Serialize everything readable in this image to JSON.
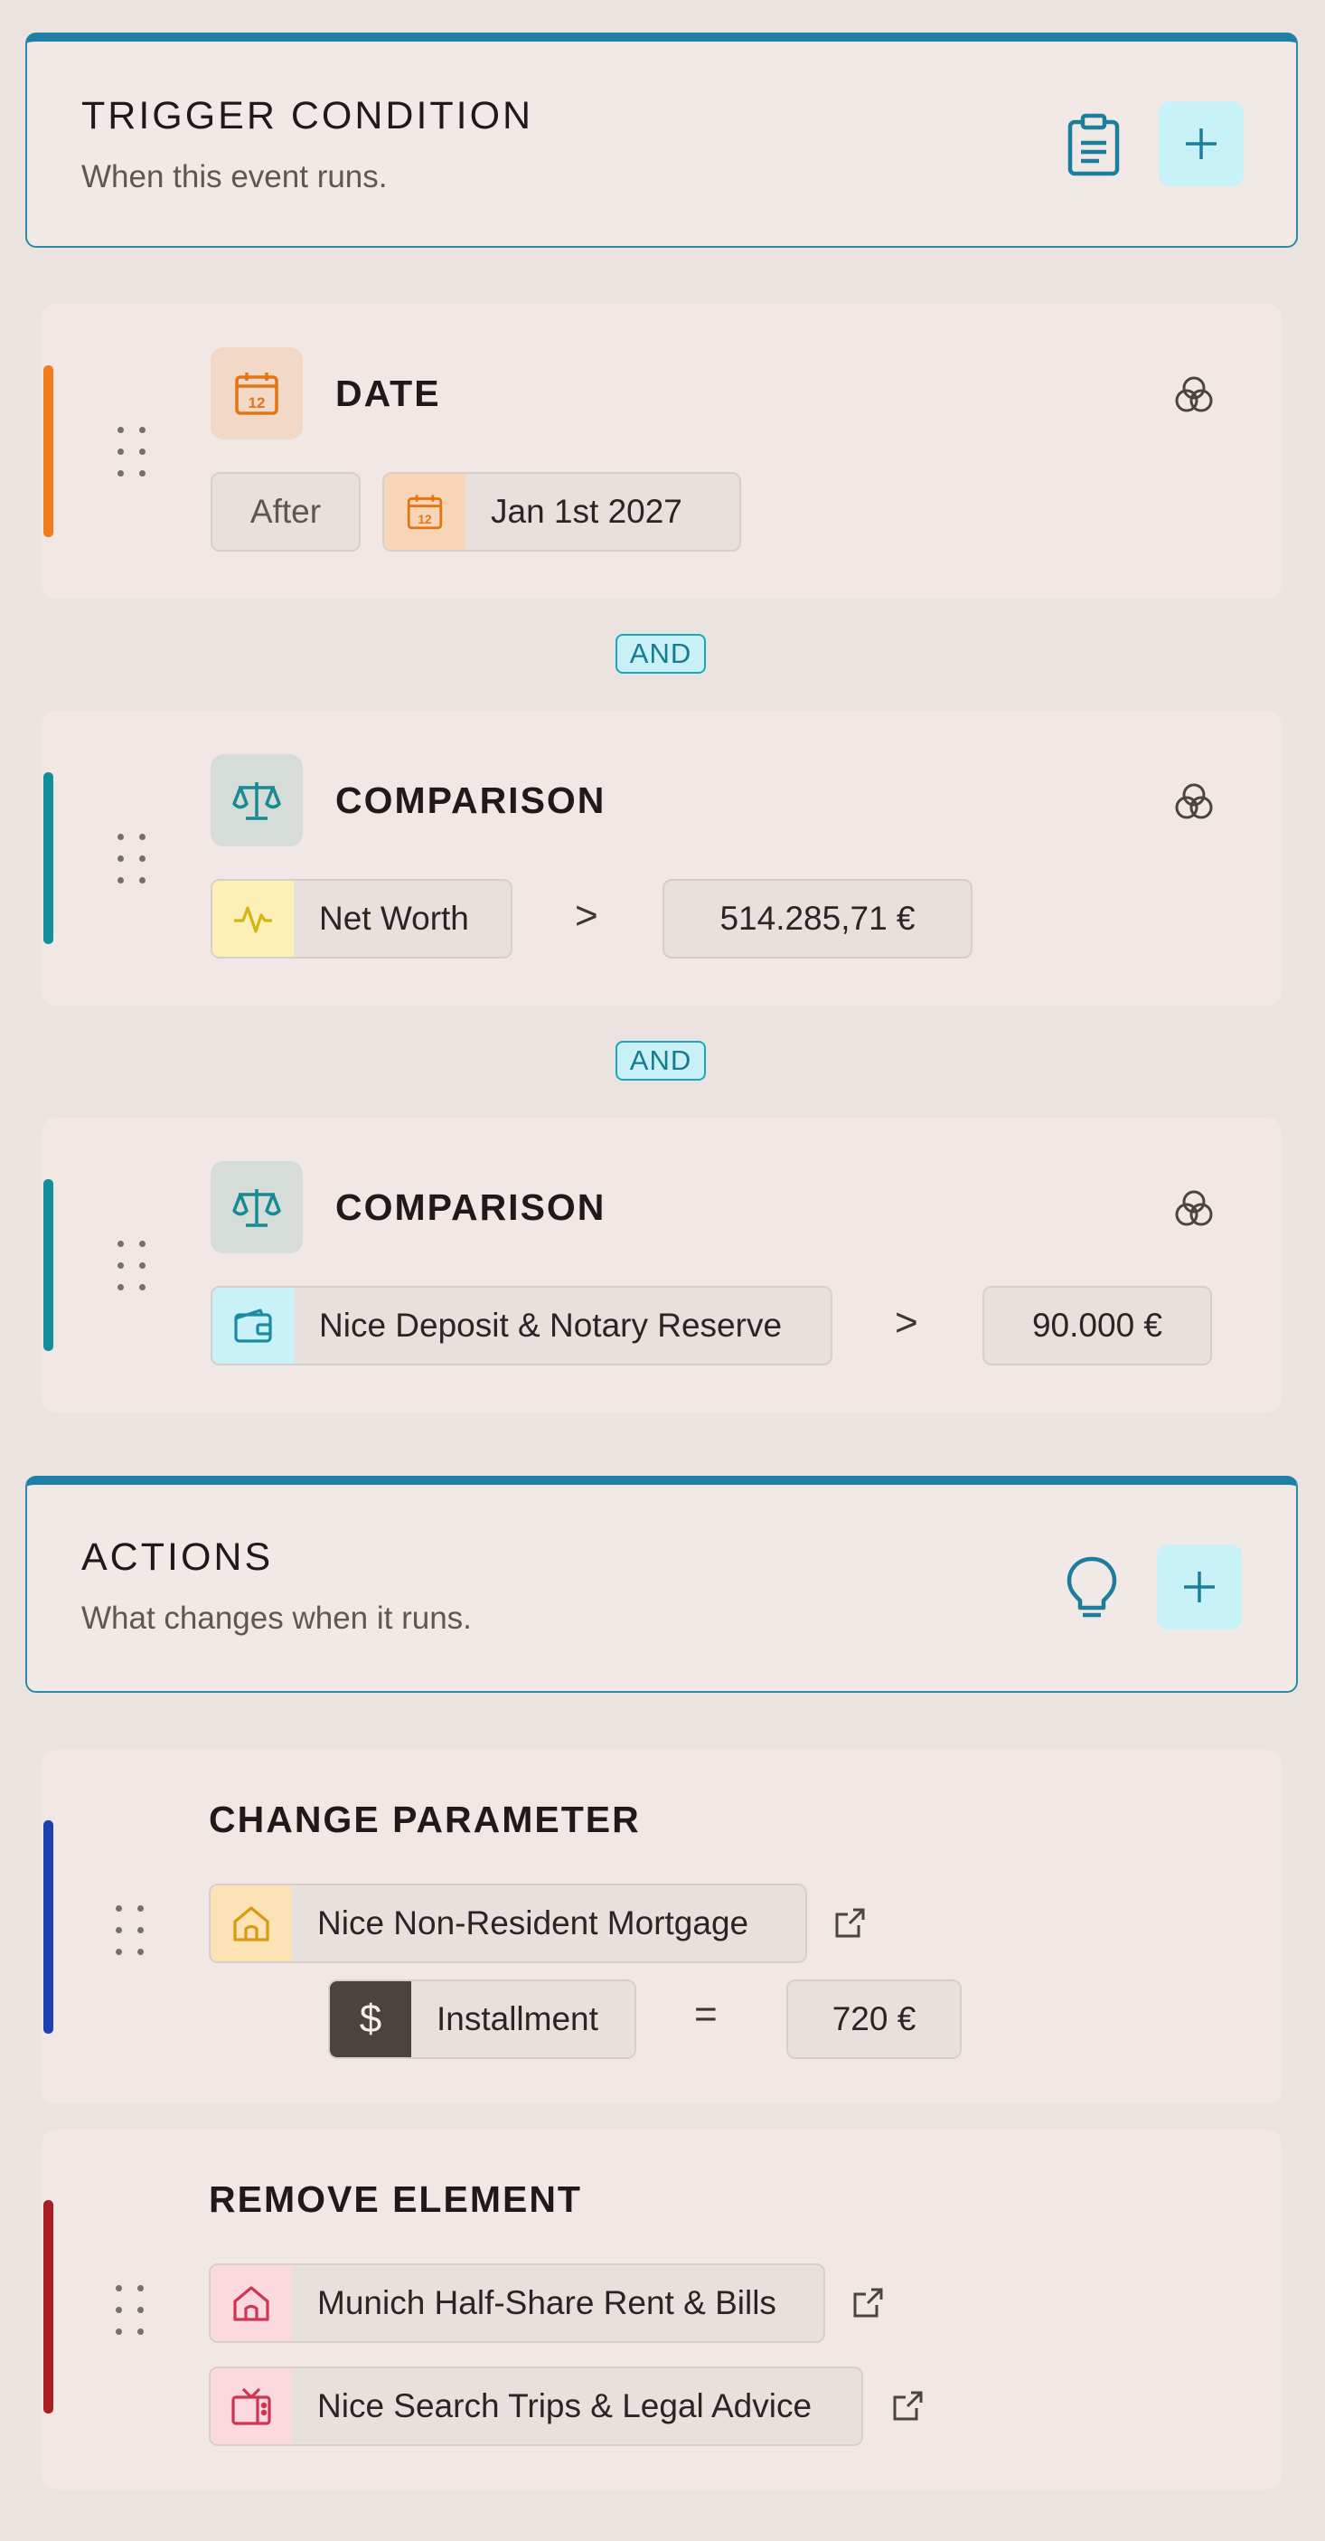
{
  "trigger": {
    "title": "TRIGGER CONDITION",
    "subtitle": "When this event runs.",
    "icons": [
      "clipboard-icon",
      "plus-icon"
    ]
  },
  "conditions": [
    {
      "type": "DATE",
      "accent": "#f07d19",
      "operator_label": "After",
      "value": "Jan 1st 2027",
      "icon": "calendar-icon"
    },
    {
      "connector": "AND",
      "type": "COMPARISON",
      "accent": "#138f99",
      "left_label": "Net Worth",
      "left_icon": "activity-icon",
      "operator": ">",
      "right_value": "514.285,71 €"
    },
    {
      "connector": "AND",
      "type": "COMPARISON",
      "accent": "#138f99",
      "left_label": "Nice Deposit & Notary Reserve",
      "left_icon": "wallet-icon",
      "operator": ">",
      "right_value": "90.000 €"
    }
  ],
  "actions": {
    "title": "ACTIONS",
    "subtitle": "What changes when it runs.",
    "icons": [
      "lightbulb-icon",
      "plus-icon"
    ],
    "items": [
      {
        "type": "CHANGE PARAMETER",
        "accent": "#1e3fb0",
        "target": "Nice Non-Resident Mortgage",
        "parameter": "Installment",
        "operator": "=",
        "value": "720 €"
      },
      {
        "type": "REMOVE ELEMENT",
        "accent": "#a81e22",
        "targets": [
          "Munich Half-Share Rent & Bills",
          "Nice Search Trips & Legal Advice"
        ]
      }
    ]
  }
}
